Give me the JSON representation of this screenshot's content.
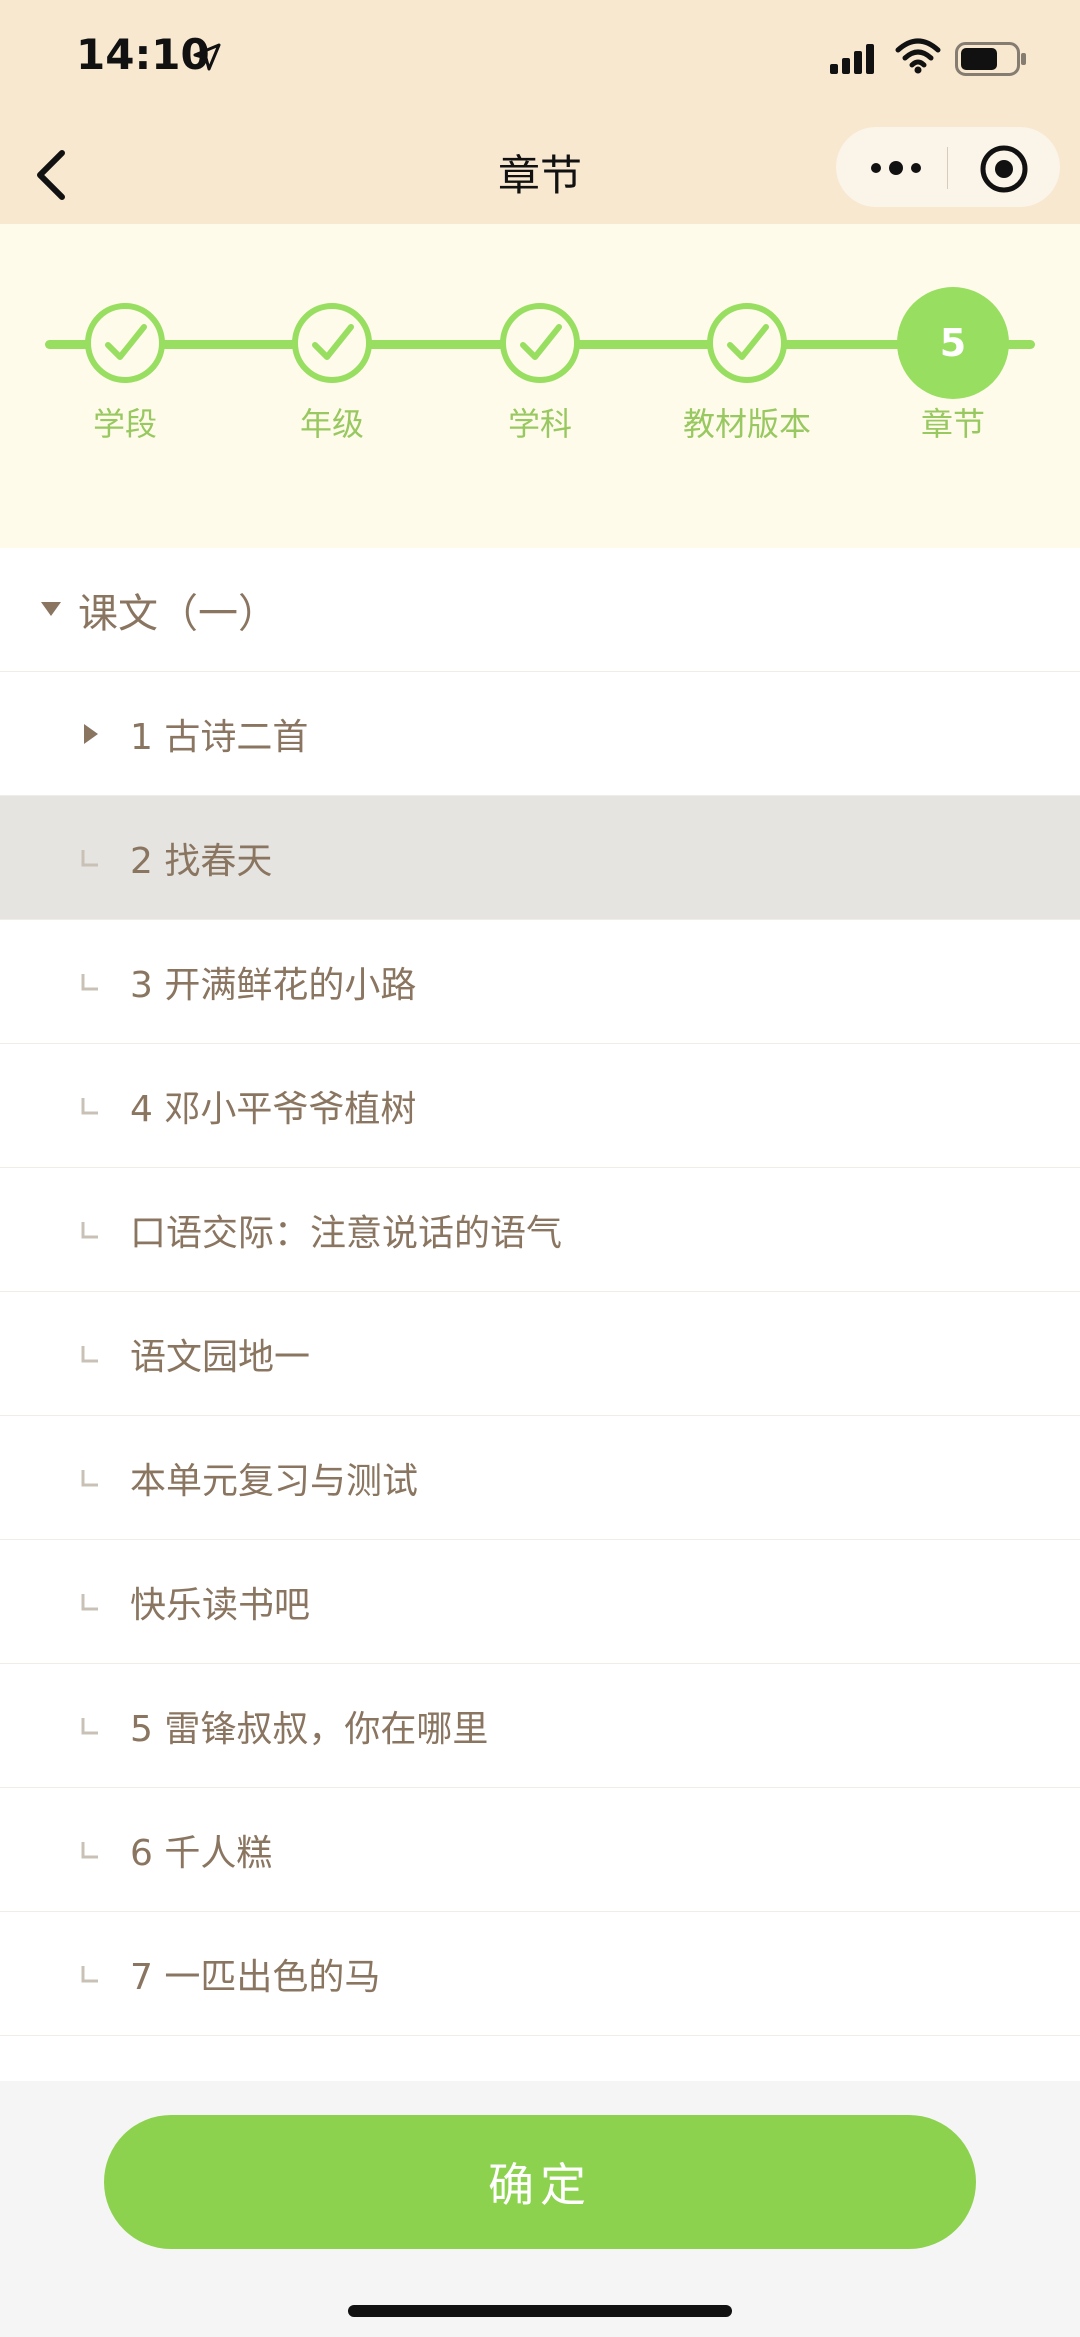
{
  "status_bar": {
    "time": "14:10"
  },
  "nav": {
    "title": "章节"
  },
  "steps": [
    {
      "label": "学段",
      "state": "done"
    },
    {
      "label": "年级",
      "state": "done"
    },
    {
      "label": "学科",
      "state": "done"
    },
    {
      "label": "教材版本",
      "state": "done"
    },
    {
      "label": "章节",
      "state": "current",
      "number": "5"
    }
  ],
  "list": {
    "unit_title": "课文（一）",
    "items": [
      {
        "label": "1 古诗二首"
      },
      {
        "label": "2 找春天"
      },
      {
        "label": "3 开满鲜花的小路"
      },
      {
        "label": "4 邓小平爷爷植树"
      },
      {
        "label": "口语交际：注意说话的语气"
      },
      {
        "label": "语文园地一"
      },
      {
        "label": "本单元复习与测试"
      },
      {
        "label": "快乐读书吧"
      },
      {
        "label": "5 雷锋叔叔，你在哪里"
      },
      {
        "label": "6 千人糕"
      },
      {
        "label": "7 一匹出色的马"
      }
    ]
  },
  "footer": {
    "confirm_label": "确定"
  },
  "colors": {
    "header_bg": "#f8e8d0",
    "stepper_bg": "#fffbeb",
    "accent_green": "#98de60",
    "button_green": "#8dd24f",
    "text_brown": "#8a7560",
    "selected_row_bg": "#e6e4e1"
  }
}
